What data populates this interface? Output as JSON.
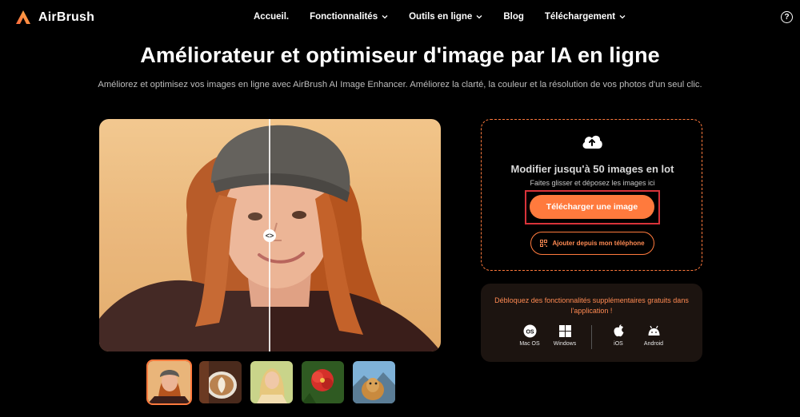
{
  "brand": {
    "name": "AirBrush",
    "accent": "#ff7a3d"
  },
  "nav": {
    "items": [
      {
        "label": "Accueil.",
        "dropdown": false
      },
      {
        "label": "Fonctionnalités",
        "dropdown": true
      },
      {
        "label": "Outils en ligne",
        "dropdown": true
      },
      {
        "label": "Blog",
        "dropdown": false
      },
      {
        "label": "Téléchargement",
        "dropdown": true
      }
    ],
    "help_label": "?"
  },
  "hero": {
    "title": "Améliorateur et optimiseur d'image par IA en ligne",
    "subtitle": "Améliorez et optimisez vos images en ligne avec AirBrush AI Image Enhancer. Améliorez la clarté, la couleur et la résolution de vos photos d'un seul clic."
  },
  "compare": {
    "handle_label": "<>"
  },
  "thumbnails": [
    {
      "name": "portrait-woman-beanie",
      "selected": true
    },
    {
      "name": "coffee-latte-art",
      "selected": false
    },
    {
      "name": "blonde-woman",
      "selected": false
    },
    {
      "name": "red-flower",
      "selected": false
    },
    {
      "name": "dog-mountains",
      "selected": false
    }
  ],
  "upload": {
    "title": "Modifier jusqu'à 50 images en lot",
    "hint": "Faites glisser et déposez les images ici",
    "upload_button": "Télécharger une image",
    "phone_button": "Ajouter depuis mon téléphone",
    "highlight_color": "#d8333a"
  },
  "app_promo": {
    "message": "Débloquez des fonctionnalités supplémentaires gratuits dans l'application !",
    "platforms": [
      {
        "label": "Mac OS",
        "icon": "macos-icon"
      },
      {
        "label": "Windows",
        "icon": "windows-icon"
      },
      {
        "label": "iOS",
        "icon": "apple-icon"
      },
      {
        "label": "Android",
        "icon": "android-icon"
      }
    ]
  }
}
